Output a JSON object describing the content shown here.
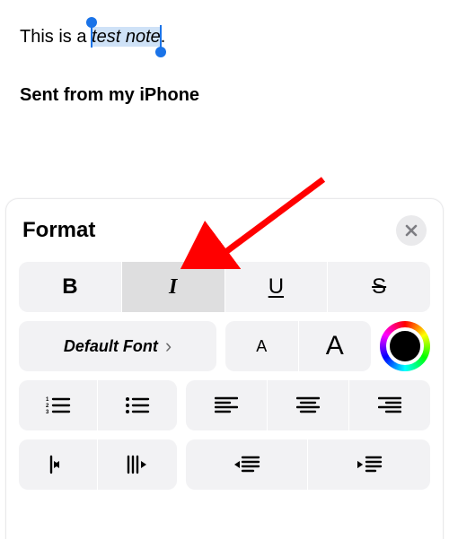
{
  "editor": {
    "line1_prefix": "This is a ",
    "line1_selected": "test note",
    "line1_suffix": ".",
    "signature": "Sent from my iPhone"
  },
  "panel": {
    "title": "Format",
    "font_label": "Default Font",
    "buttons": {
      "bold": "B",
      "italic": "I",
      "underline": "U",
      "strike": "S",
      "small_a": "A",
      "big_a": "A"
    }
  }
}
